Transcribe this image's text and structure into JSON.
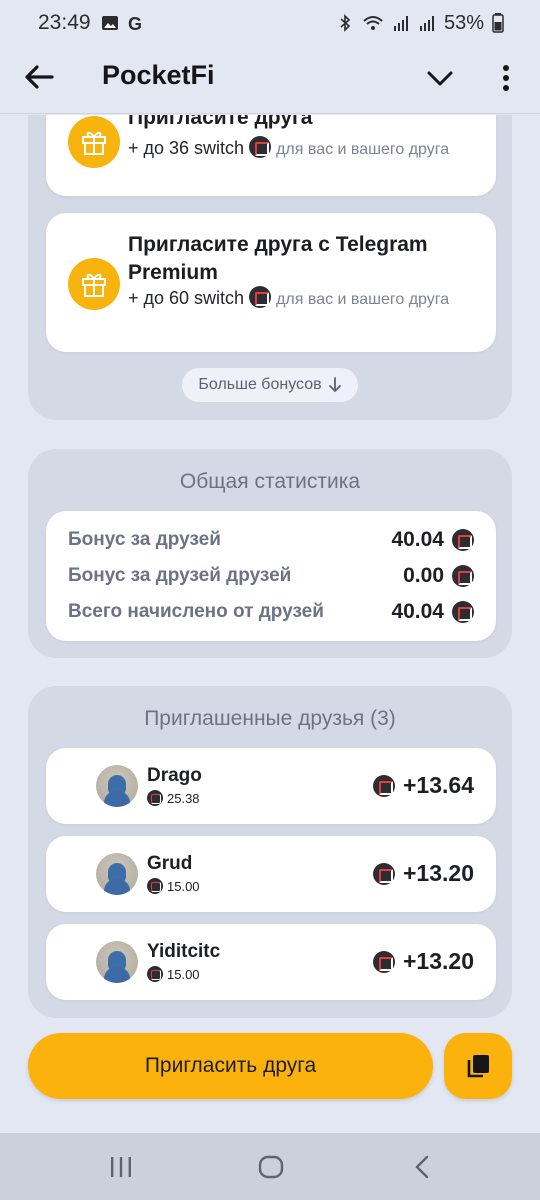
{
  "status_bar": {
    "time": "23:49",
    "battery": "53%",
    "icons": [
      "image-icon",
      "google-icon",
      "bluetooth-icon",
      "wifi-icon",
      "signal-icon",
      "battery-icon"
    ]
  },
  "app_bar": {
    "title": "PocketFi",
    "icons": [
      "back-arrow-icon",
      "chevron-down-icon",
      "more-vert-icon"
    ]
  },
  "bonuses": {
    "items": [
      {
        "title": "Пригласите друга",
        "reward": "+ до 36 switch",
        "note": "для вас и вашего друга"
      },
      {
        "title": "Пригласите друга с Telegram Premium",
        "reward": "+ до 60 switch",
        "note": "для вас и вашего друга"
      }
    ],
    "more_label": "Больше бонусов",
    "more_icon": "arrow-down-icon"
  },
  "stats": {
    "title": "Общая статистика",
    "rows": [
      {
        "label": "Бонус за друзей",
        "value": "40.04"
      },
      {
        "label": "Бонус за друзей друзей",
        "value": "0.00"
      },
      {
        "label": "Всего начислено от друзей",
        "value": "40.04"
      }
    ]
  },
  "friends": {
    "title": "Приглашенные друзья (3)",
    "items": [
      {
        "name": "Drago",
        "balance": "25.38",
        "earned": "+13.64"
      },
      {
        "name": "Grud",
        "balance": "15.00",
        "earned": "+13.20"
      },
      {
        "name": "Yiditcitc",
        "balance": "15.00",
        "earned": "+13.20"
      }
    ]
  },
  "actions": {
    "invite_label": "Пригласить друга",
    "copy_icon": "copy-icon"
  },
  "colors": {
    "accent": "#fbb20d",
    "background": "#e3e7f2",
    "panel": "#d4d9e6",
    "muted_text": "#6b7384"
  }
}
